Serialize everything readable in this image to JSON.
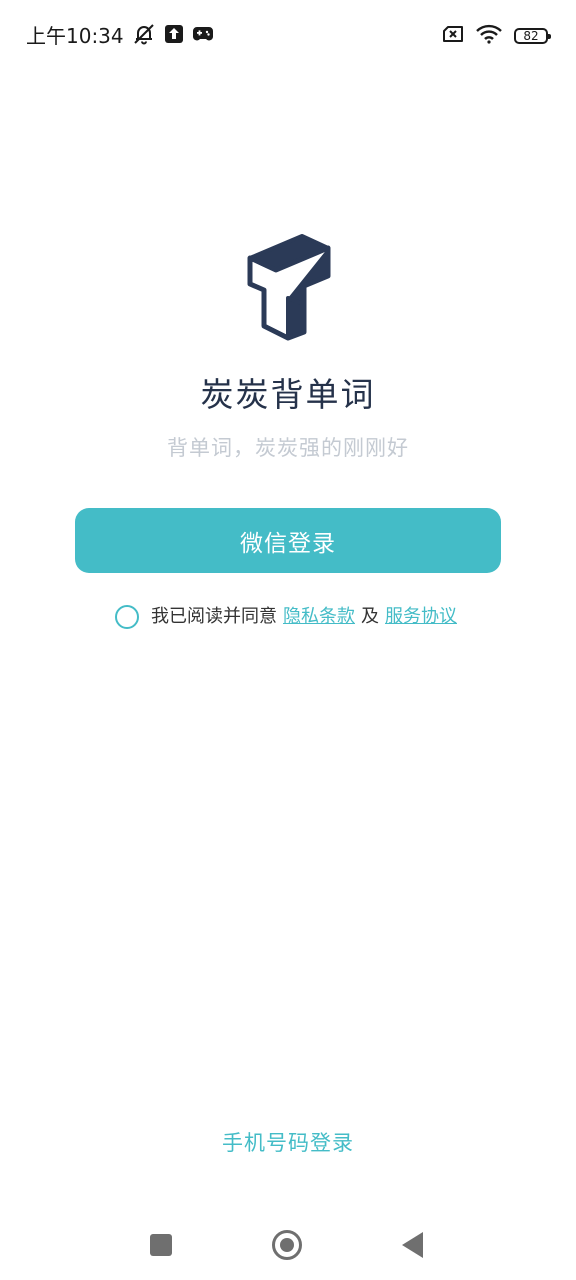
{
  "status_bar": {
    "time": "上午10:34",
    "battery_level": "82",
    "icons": [
      "mute-bell-icon",
      "upload-icon",
      "gamepad-icon",
      "sim-error-icon",
      "wifi-icon",
      "battery-icon"
    ]
  },
  "app": {
    "logo_icon": "t-logo-icon",
    "title": "炭炭背单词",
    "slogan": "背单词，炭炭强的刚刚好"
  },
  "login": {
    "wechat_label": "微信登录",
    "phone_label": "手机号码登录"
  },
  "agreement": {
    "prefix": "我已阅读并同意",
    "privacy_link": "隐私条款",
    "and": "及",
    "service_link": "服务协议"
  },
  "nav_bar": {
    "icons": [
      "recent-apps-icon",
      "home-icon",
      "back-icon"
    ]
  },
  "colors": {
    "accent": "#44bcc7",
    "title": "#25324a",
    "slogan": "#c4cad2",
    "logo": "#2b3a57"
  }
}
